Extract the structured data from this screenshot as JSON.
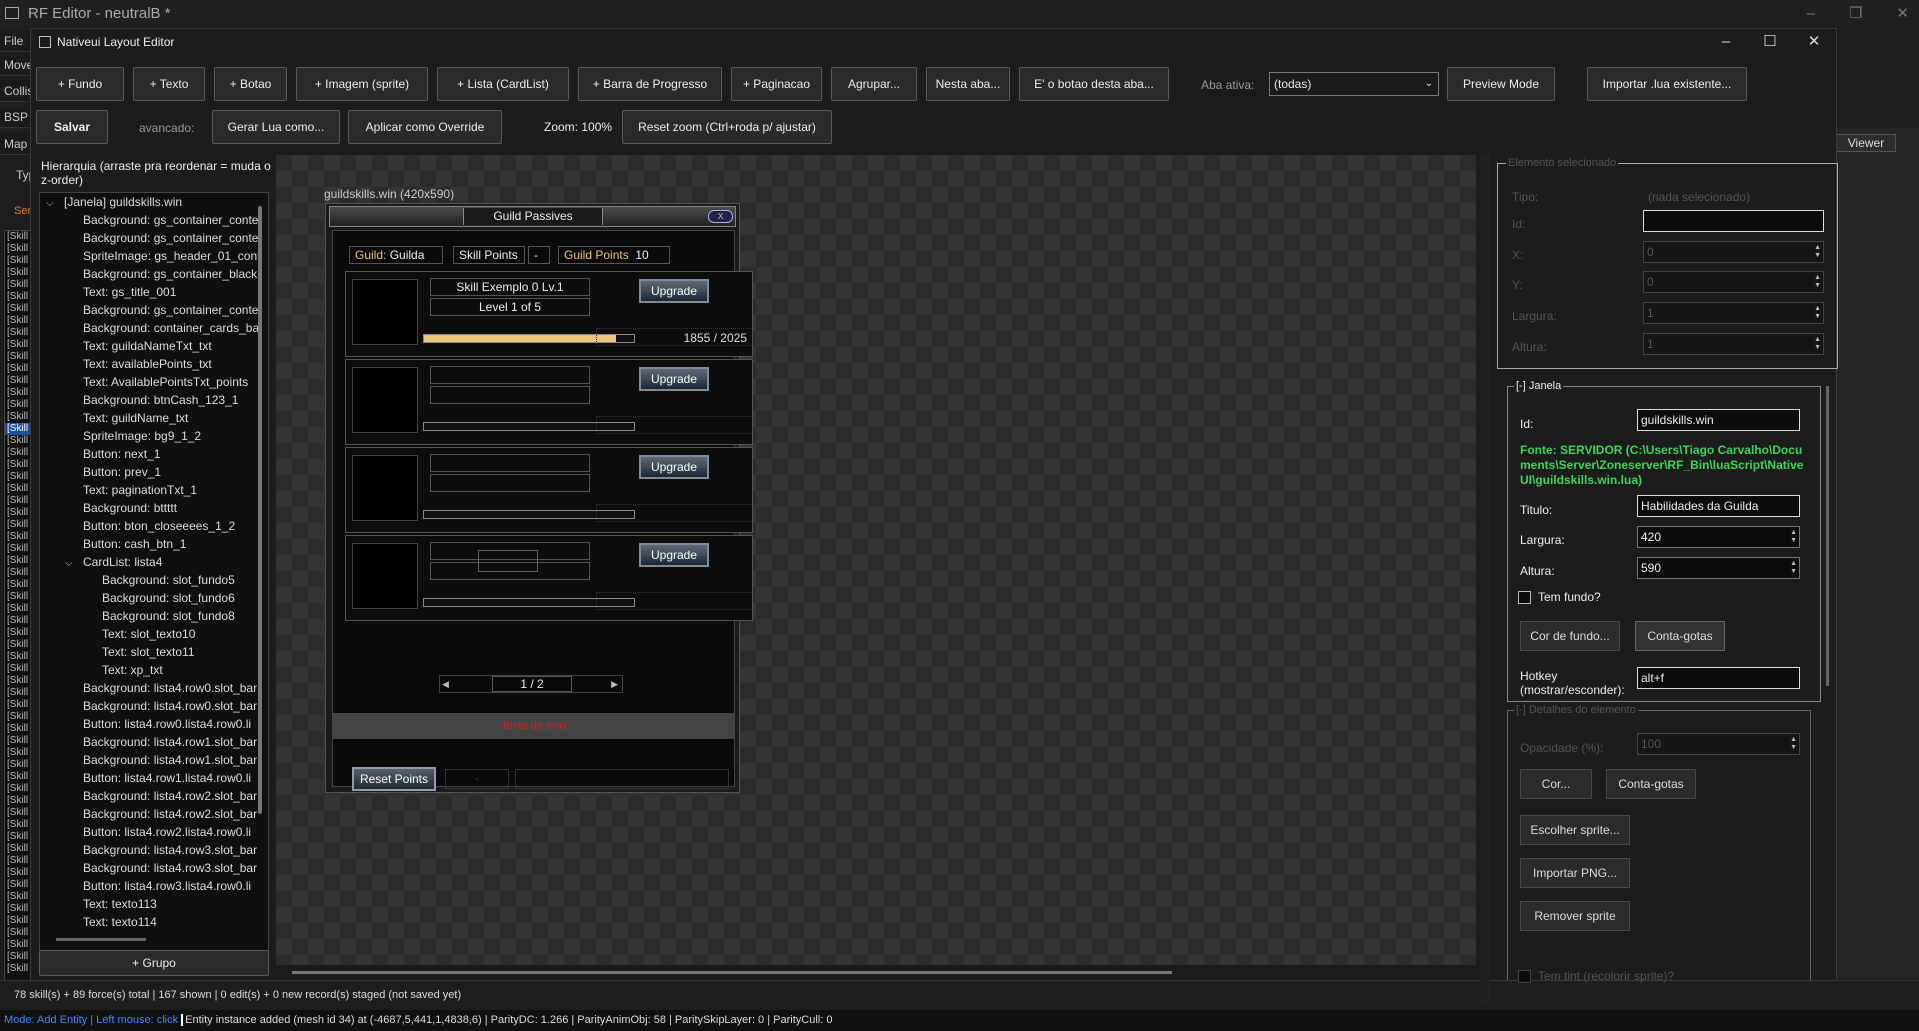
{
  "bg_app": {
    "title": "RF Editor - neutralB *",
    "menu": [
      "File",
      "Move",
      "Collis",
      "BSP M",
      "Map",
      "Typ",
      "Serv"
    ],
    "viewer_tab": "Viewer",
    "left_list": [
      "[Skill",
      "[Skill",
      "[Skill",
      "[Skill",
      "[Skill",
      "[Skill",
      "[Skill",
      "[Skill",
      "[Skill",
      "[Skill",
      "[Skill",
      "[Skill",
      "[Skill",
      "[Skill",
      "[Skill",
      "[Skill",
      "[Skill",
      "[Skill",
      "[Skill",
      "[Skill",
      "[Skill",
      "[Skill",
      "[Skill",
      "[Skill",
      "[Skill",
      "[Skill",
      "[Skill",
      "[Skill",
      "[Skill",
      "[Skill",
      "[Skill",
      "[Skill",
      "[Skill",
      "[Skill",
      "[Skill",
      "[Skill",
      "[Skill",
      "[Skill",
      "[Skill",
      "[Skill",
      "[Skill",
      "[Skill",
      "[Skill",
      "[Skill",
      "[Skill",
      "[Skill",
      "[Skill",
      "[Skill",
      "[Skill",
      "[Skill",
      "[Skill",
      "[Skill",
      "[Skill",
      "[Skill",
      "[Skill",
      "[Skill",
      "[Skill",
      "[Skill",
      "[Skill",
      "[Skill",
      "[Skill",
      "[Skill"
    ],
    "selected_index": 16,
    "bottom_status": "78 skill(s) + 89 force(s) total | 167 shown | 0 edit(s) + 0 new record(s) staged (not saved yet)",
    "status_mode": "Mode: Add Entity",
    "status_sep": "|",
    "status_mouse": "Left mouse: click",
    "status_text": "Entity instance added (mesh id 34) at (-4687,5,441,1,4838,6) | ParityDC: 1.266 | ParityAnimObj: 58 | ParitySkipLayer: 0 | ParityCull: 0"
  },
  "editor": {
    "title": "Nativeui Layout Editor",
    "toolbar1": [
      "+ Fundo",
      "+ Texto",
      "+ Botao",
      "+ Imagem (sprite)",
      "+ Lista (CardList)",
      "+ Barra de Progresso",
      "+ Paginacao",
      "Agrupar...",
      "Nesta aba...",
      "E' o botao desta aba..."
    ],
    "aba_label": "Aba ativa:",
    "aba_value": "(todas)",
    "preview": "Preview Mode",
    "import": "Importar .lua existente...",
    "save": "Salvar",
    "avancado": "avancado:",
    "gerar": "Gerar Lua como...",
    "aplicar": "Aplicar como Override",
    "zoom": "Zoom: 100%",
    "reset_zoom": "Reset zoom (Ctrl+roda p/ ajustar)"
  },
  "hierarchy": {
    "label": "Hierarquia (arraste pra reordenar = muda o z-order)",
    "group_button": "+ Grupo",
    "rows": [
      {
        "t": "[Janela] guildskills.win",
        "d": 0,
        "exp": true
      },
      {
        "t": "Background: gs_container_conte",
        "d": 1
      },
      {
        "t": "Background: gs_container_conte",
        "d": 1
      },
      {
        "t": "SpriteImage: gs_header_01_cont",
        "d": 1
      },
      {
        "t": "Background: gs_container_black",
        "d": 1
      },
      {
        "t": "Text: gs_title_001",
        "d": 1
      },
      {
        "t": "Background: gs_container_conte",
        "d": 1
      },
      {
        "t": "Background: container_cards_ba",
        "d": 1
      },
      {
        "t": "Text: guildaNameTxt_txt",
        "d": 1
      },
      {
        "t": "Text: availablePoints_txt",
        "d": 1
      },
      {
        "t": "Text: AvailablePointsTxt_points",
        "d": 1
      },
      {
        "t": "Background: btnCash_123_1",
        "d": 1
      },
      {
        "t": "Text: guildName_txt",
        "d": 1
      },
      {
        "t": "SpriteImage: bg9_1_2",
        "d": 1
      },
      {
        "t": "Button: next_1",
        "d": 1
      },
      {
        "t": "Button: prev_1",
        "d": 1
      },
      {
        "t": "Text: paginationTxt_1",
        "d": 1
      },
      {
        "t": "Background: bttttt",
        "d": 1
      },
      {
        "t": "Button: bton_closeeees_1_2",
        "d": 1
      },
      {
        "t": "Button: cash_btn_1",
        "d": 1
      },
      {
        "t": "CardList: lista4",
        "d": 1,
        "exp": true
      },
      {
        "t": "Background: slot_fundo5",
        "d": 2
      },
      {
        "t": "Background: slot_fundo6",
        "d": 2
      },
      {
        "t": "Background: slot_fundo8",
        "d": 2
      },
      {
        "t": "Text: slot_texto10",
        "d": 2
      },
      {
        "t": "Text: slot_texto11",
        "d": 2
      },
      {
        "t": "Text: xp_txt",
        "d": 2
      },
      {
        "t": "Background: lista4.row0.slot_bar",
        "d": 1
      },
      {
        "t": "Background: lista4.row0.slot_bar",
        "d": 1
      },
      {
        "t": "Button: lista4.row0.lista4.row0.li",
        "d": 1
      },
      {
        "t": "Background: lista4.row1.slot_bar",
        "d": 1
      },
      {
        "t": "Background: lista4.row1.slot_bar",
        "d": 1
      },
      {
        "t": "Button: lista4.row1.lista4.row0.li",
        "d": 1
      },
      {
        "t": "Background: lista4.row2.slot_bar",
        "d": 1
      },
      {
        "t": "Background: lista4.row2.slot_bar",
        "d": 1
      },
      {
        "t": "Button: lista4.row2.lista4.row0.li",
        "d": 1
      },
      {
        "t": "Background: lista4.row3.slot_bar",
        "d": 1
      },
      {
        "t": "Background: lista4.row3.slot_bar",
        "d": 1
      },
      {
        "t": "Button: lista4.row3.lista4.row0.li",
        "d": 1
      },
      {
        "t": "Text: texto113",
        "d": 1
      },
      {
        "t": "Text: texto114",
        "d": 1
      }
    ]
  },
  "preview": {
    "caption": "guildskills.win  (420x590)",
    "title": "Guild Passives",
    "close": "X",
    "guild_label": "Guild:",
    "guild_value": "Guilda",
    "sp_label": "Skill Points",
    "sp_value": "-",
    "gp_label": "Guild Points",
    "gp_value": "10",
    "cards": [
      {
        "name": "Skill Exemplo 0 Lv.1",
        "level": "Level 1 of 5",
        "progress": "1855 / 2025",
        "fill": 0.916,
        "upgrade": "Upgrade"
      },
      {
        "name": "",
        "level": "",
        "progress": "",
        "fill": 0,
        "upgrade": "Upgrade"
      },
      {
        "name": "",
        "level": "",
        "progress": "",
        "fill": 0,
        "upgrade": "Upgrade"
      },
      {
        "name": "",
        "level": "",
        "progress": "",
        "fill": 0,
        "upgrade": "Upgrade"
      }
    ],
    "page": "1 / 2",
    "error": "Texto de erro",
    "reset": "Reset Points",
    "reset_dash": "-"
  },
  "props": {
    "sel_title": "Elemento selecionado",
    "tipo_label": "Tipo:",
    "tipo_value": "(nada selecionado)",
    "id_label": "Id:",
    "x_label": "X:",
    "x_value": "0",
    "y_label": "Y:",
    "y_value": "0",
    "w_label": "Largura:",
    "w_value": "1",
    "h_label": "Altura:",
    "h_value": "1",
    "janela_title": "[-] Janela",
    "j_id_label": "Id:",
    "j_id": "guildskills.win",
    "fonte": "Fonte: SERVIDOR  (C:\\Users\\Tiago Carvalho\\Documents\\Server\\Zoneserver\\RF_Bin\\luaScript\\NativeUI\\guildskills.win.lua)",
    "titulo_label": "Titulo:",
    "titulo": "Habilidades da Guilda",
    "largura_label": "Largura:",
    "largura": "420",
    "altura_label": "Altura:",
    "altura": "590",
    "tem_fundo": "Tem fundo?",
    "cor_fundo": "Cor de fundo...",
    "conta_gotas": "Conta-gotas",
    "hotkey_label": "Hotkey (mostrar/esconder):",
    "hotkey": "alt+f",
    "det_title": "[-] Detalhes do elemento",
    "opac_label": "Opacidade (%):",
    "opac": "100",
    "cor": "Cor...",
    "conta_gotas2": "Conta-gotas",
    "escolher": "Escolher sprite...",
    "importar_png": "Importar PNG...",
    "remover": "Remover sprite",
    "tint": "Tem tint (recolorir sprite)?"
  },
  "colors": {
    "accent_green": "#3fd35a",
    "status_blue": "#3b8bff",
    "gold": "#e8c47a",
    "error_red": "#d02020"
  }
}
